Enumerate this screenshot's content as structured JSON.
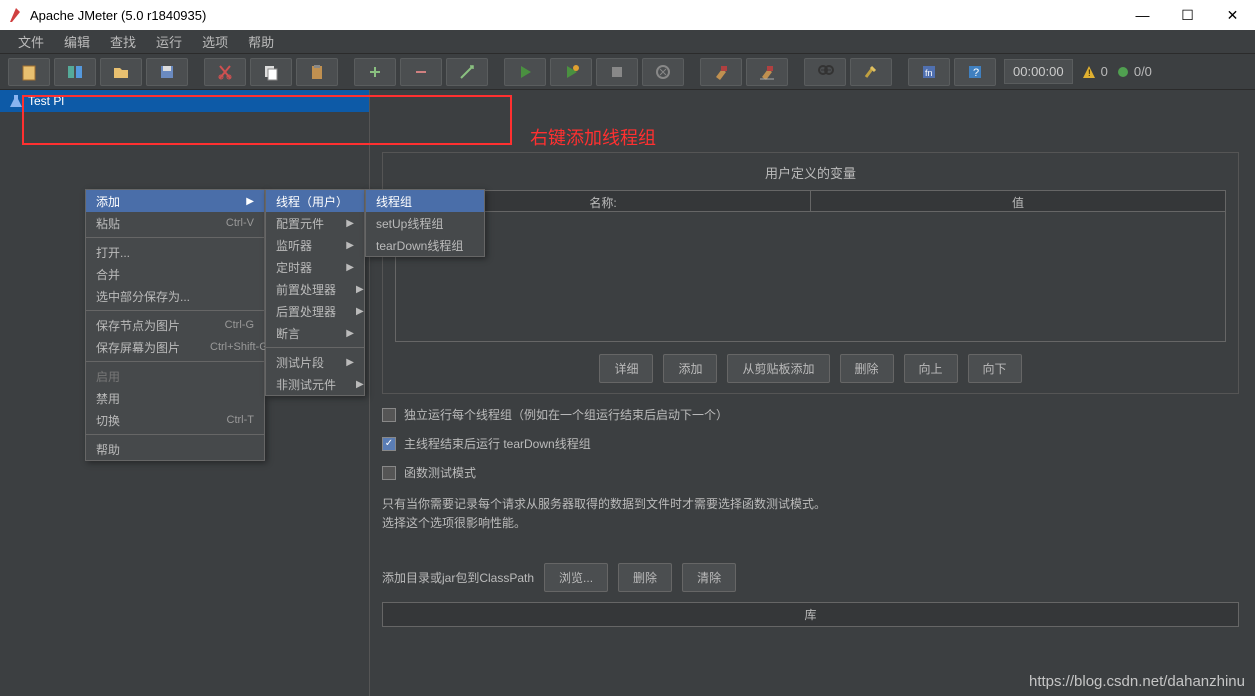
{
  "title": "Apache JMeter (5.0 r1840935)",
  "menubar": [
    "文件",
    "编辑",
    "查找",
    "运行",
    "选项",
    "帮助"
  ],
  "toolbar": {
    "timer": "00:00:00",
    "warn_count": "0",
    "err_count": "0/0"
  },
  "tree": {
    "root": "Test Pl"
  },
  "context_menu_1": [
    {
      "label": "添加",
      "selected": true,
      "arrow": true
    },
    {
      "label": "粘贴",
      "shortcut": "Ctrl-V"
    },
    {
      "sep": true
    },
    {
      "label": "打开..."
    },
    {
      "label": "合并"
    },
    {
      "label": "选中部分保存为..."
    },
    {
      "sep": true
    },
    {
      "label": "保存节点为图片",
      "shortcut": "Ctrl-G"
    },
    {
      "label": "保存屏幕为图片",
      "shortcut": "Ctrl+Shift-G"
    },
    {
      "sep": true
    },
    {
      "label": "启用",
      "disabled": true
    },
    {
      "label": "禁用"
    },
    {
      "label": "切换",
      "shortcut": "Ctrl-T"
    },
    {
      "sep": true
    },
    {
      "label": "帮助"
    }
  ],
  "context_menu_2": [
    {
      "label": "线程（用户）",
      "selected": true,
      "arrow": true
    },
    {
      "label": "配置元件",
      "arrow": true
    },
    {
      "label": "监听器",
      "arrow": true
    },
    {
      "label": "定时器",
      "arrow": true
    },
    {
      "label": "前置处理器",
      "arrow": true
    },
    {
      "label": "后置处理器",
      "arrow": true
    },
    {
      "label": "断言",
      "arrow": true
    },
    {
      "sep": true
    },
    {
      "label": "测试片段",
      "arrow": true
    },
    {
      "label": "非测试元件",
      "arrow": true
    }
  ],
  "context_menu_3": [
    {
      "label": "线程组",
      "selected": true
    },
    {
      "label": "setUp线程组"
    },
    {
      "label": "tearDown线程组"
    }
  ],
  "annotation": "右键添加线程组",
  "right_panel": {
    "section_title": "用户定义的变量",
    "col_name": "名称:",
    "col_value": "值",
    "field_suffix": ":",
    "btn_detail": "详细",
    "btn_add": "添加",
    "btn_from_clipboard": "从剪贴板添加",
    "btn_delete": "删除",
    "btn_up": "向上",
    "btn_down": "向下",
    "check1": "独立运行每个线程组（例如在一个组运行结束后启动下一个）",
    "check2": "主线程结束后运行 tearDown线程组",
    "check3": "函数测试模式",
    "hint1": "只有当你需要记录每个请求从服务器取得的数据到文件时才需要选择函数测试模式。",
    "hint2": "选择这个选项很影响性能。",
    "classpath_label": "添加目录或jar包到ClassPath",
    "btn_browse": "浏览...",
    "btn_delete2": "删除",
    "btn_clear": "清除",
    "lib_head": "库"
  },
  "watermark": "https://blog.csdn.net/dahanzhinu"
}
